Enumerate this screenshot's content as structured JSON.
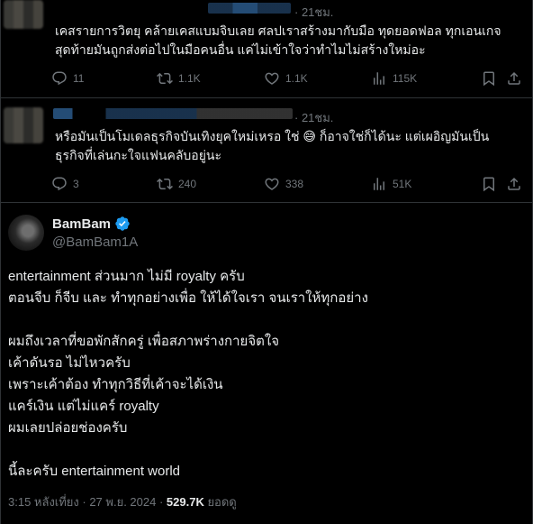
{
  "replies": [
    {
      "time": "· 21ชม.",
      "text_lines": [
        "เคสรายการวิตยุ คล้ายเคสแบมจิบเลย ศลปเราสร้างมากับมือ ทุดยอดฟอล ทุกเอนเกจ",
        "สุดท้ายมันถูกส่งต่อไปในมือคนอื่น แค่ไม่เข้าใจว่าทำไมไม่สร้างใหม่อะ"
      ],
      "stats": {
        "replies": "11",
        "retweets": "1.1K",
        "likes": "1.1K",
        "views": "115K"
      }
    },
    {
      "time": "· 21ชม.",
      "text_lines": [
        "หรือมันเป็นโมเดลธุรกิจบันเทิงยุคใหม่เหรอ ใช่ 😅 ก็อาจใช่ก็ได้นะ แต่เผอิญมันเป็น",
        "ธุรกิจที่เล่นกะใจแฟนคลับอยู่นะ"
      ],
      "stats": {
        "replies": "3",
        "retweets": "240",
        "likes": "338",
        "views": "51K"
      }
    }
  ],
  "main_tweet": {
    "display_name": "BamBam",
    "handle": "@BamBam1A",
    "paragraphs": [
      [
        "entertainment ส่วนมาก ไม่มี royalty ครับ",
        "ตอนจีบ ก็จีบ และ ทำทุกอย่างเพื่อ ให้ได้ใจเรา จนเราให้ทุกอย่าง"
      ],
      [
        "ผมถึงเวลาที่ขอพักสักครู่ เพื่อสภาพร่างกายจิตใจ",
        "เค้าดันรอ ไม่ไหวครับ",
        "เพราะเค้าต้อง ทำทุกวิธีที่เค้าจะได้เงิน",
        "แคร์เงิน แต่ไม่แคร์ royalty",
        "ผมเลยปล่อยช่องครับ"
      ],
      [
        "นี้ละครับ entertainment world"
      ]
    ],
    "timestamp": "3:15 หลังเที่ยง · 27 พ.ย. 2024 · ",
    "views_count": "529.7K",
    "views_label": " ยอดดู"
  },
  "colors": {
    "background": "#000000",
    "text": "#e7e9ea",
    "muted": "#71767b",
    "divider": "#2f3336",
    "verified": "#1d9bf0"
  },
  "icons": [
    "reply-icon",
    "retweet-icon",
    "like-icon",
    "views-icon",
    "bookmark-icon",
    "share-icon",
    "verified-badge-icon"
  ]
}
